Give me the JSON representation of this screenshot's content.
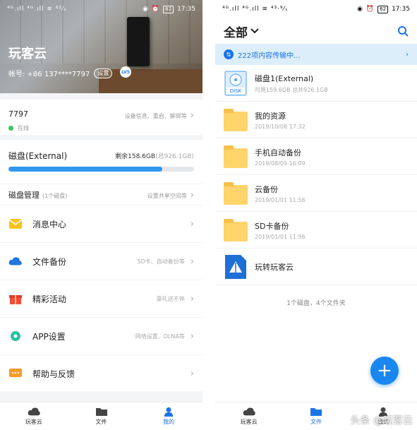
{
  "left": {
    "status": {
      "signal": "⁴ᴳ.ıll ⁴ᴳ.ıll ≋ ⁶²⁄ₛ",
      "time": "17:35",
      "battery": "62"
    },
    "header": {
      "title": "玩客云",
      "account": "帐号: +86 137****7797",
      "badge": "设置",
      "level": "LV5"
    },
    "device": {
      "name": "7797",
      "status": "在线",
      "hint": "设备信息、重启、解绑等"
    },
    "disk": {
      "name": "磁盘(External)",
      "remaining": "剩余158.6GB",
      "total": "(总926.1GB)",
      "used_fraction": 0.83,
      "manage_label": "磁盘管理",
      "manage_sub": "(1个磁盘)",
      "manage_hint": "设置共享空间等"
    },
    "menu": [
      {
        "label": "消息中心",
        "hint": "",
        "icon": "mail-icon"
      },
      {
        "label": "文件备份",
        "hint": "SD卡、自动备份等",
        "icon": "cloud-icon"
      },
      {
        "label": "精彩活动",
        "hint": "豪礼送不停",
        "icon": "gift-icon"
      },
      {
        "label": "APP设置",
        "hint": "网络设置、DLNA等",
        "icon": "gear-icon"
      },
      {
        "label": "帮助与反馈",
        "hint": "",
        "icon": "chat-icon"
      }
    ],
    "tabs": [
      {
        "label": "玩客云",
        "icon": "cloud-icon",
        "active": false
      },
      {
        "label": "文件",
        "icon": "folder-icon",
        "active": false
      },
      {
        "label": "我的",
        "icon": "person-icon",
        "active": true
      }
    ]
  },
  "right": {
    "status": {
      "signal": "⁴ᴳ.ıll ⁴ᴳ.ıll ≋ ⁴³·⁹⁄ₛ",
      "time": "17:35",
      "battery": "62"
    },
    "header": {
      "title": "全部",
      "chevron": "chevron-down-icon",
      "search": "search-icon"
    },
    "transfer": {
      "text": "222项内容传输中..."
    },
    "files": [
      {
        "name": "磁盘1(External)",
        "sub": "可用159.6GB 总共926.1GB",
        "type": "disk",
        "icon_label": "DISK"
      },
      {
        "name": "我的资源",
        "sub": "2019/10/08 17:32",
        "type": "folder"
      },
      {
        "name": "手机自动备份",
        "sub": "2019/08/09 16:09",
        "type": "folder"
      },
      {
        "name": "云备份",
        "sub": "2019/01/01 11:56",
        "type": "folder"
      },
      {
        "name": "SD卡备份",
        "sub": "2019/01/01 11:56",
        "type": "folder"
      },
      {
        "name": "玩转玩客云",
        "sub": "",
        "type": "app"
      }
    ],
    "summary": "1个磁盘，4个文件夹",
    "fab": "+",
    "tabs": [
      {
        "label": "玩客云",
        "icon": "cloud-icon",
        "active": false
      },
      {
        "label": "文件",
        "icon": "folder-icon",
        "active": true
      },
      {
        "label": "我的",
        "icon": "person-icon",
        "active": false
      }
    ],
    "watermark": "头条 @玩客云"
  },
  "colors": {
    "accent": "#1a74e8",
    "online": "#3cc45b",
    "bar": "#2f97ee",
    "folder": "#ffd46b"
  }
}
